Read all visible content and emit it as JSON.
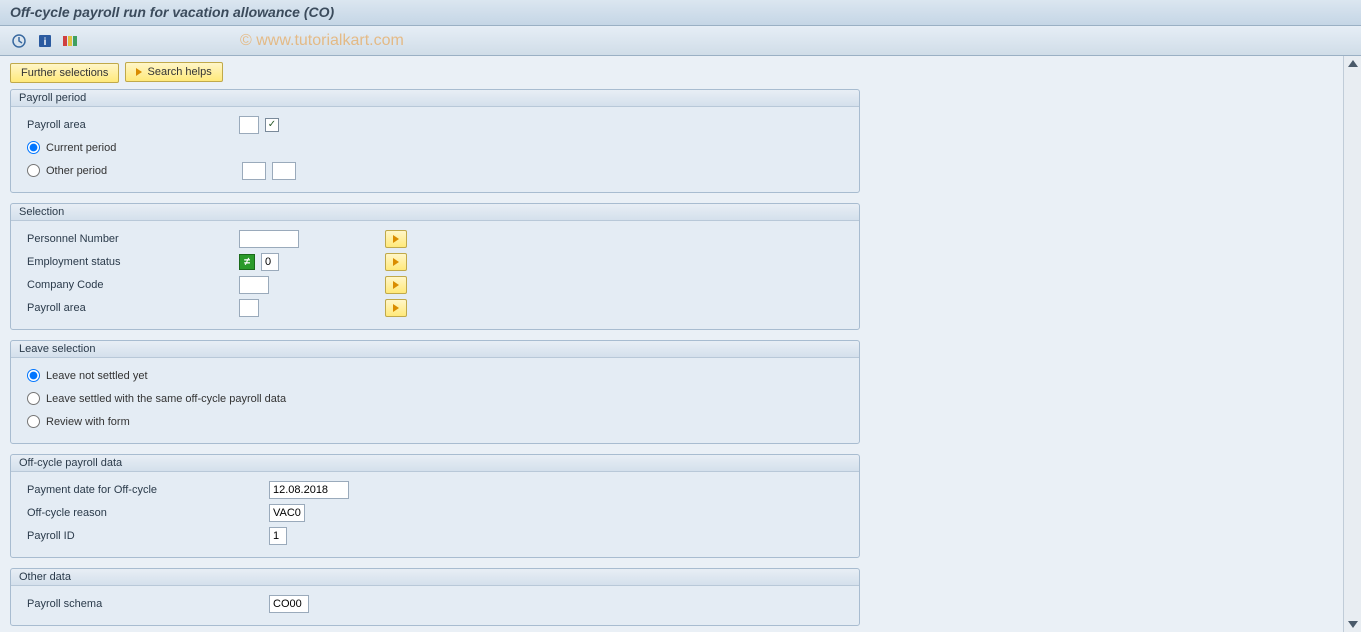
{
  "title": "Off-cycle payroll run for vacation allowance (CO)",
  "watermark": "© www.tutorialkart.com",
  "buttons": {
    "further_selections": "Further selections",
    "search_helps": "Search helps"
  },
  "groups": {
    "payroll_period": {
      "title": "Payroll period",
      "payroll_area_label": "Payroll area",
      "current_period": "Current period",
      "other_period": "Other period",
      "payroll_area_value": "",
      "other_from": "",
      "other_to": ""
    },
    "selection": {
      "title": "Selection",
      "personnel_number": "Personnel Number",
      "personnel_number_value": "",
      "employment_status": "Employment status",
      "employment_status_value": "0",
      "company_code": "Company Code",
      "company_code_value": "",
      "payroll_area": "Payroll area",
      "payroll_area_value": ""
    },
    "leave_selection": {
      "title": "Leave selection",
      "opt1": "Leave not settled yet",
      "opt2": "Leave settled with the same off-cycle payroll data",
      "opt3": "Review with form"
    },
    "offcycle_data": {
      "title": "Off-cycle payroll data",
      "payment_date_label": "Payment date for Off-cycle",
      "payment_date_value": "12.08.2018",
      "reason_label": "Off-cycle reason",
      "reason_value": "VAC0",
      "payroll_id_label": "Payroll ID",
      "payroll_id_value": "1"
    },
    "other_data": {
      "title": "Other data",
      "payroll_schema_label": "Payroll schema",
      "payroll_schema_value": "CO00"
    }
  }
}
